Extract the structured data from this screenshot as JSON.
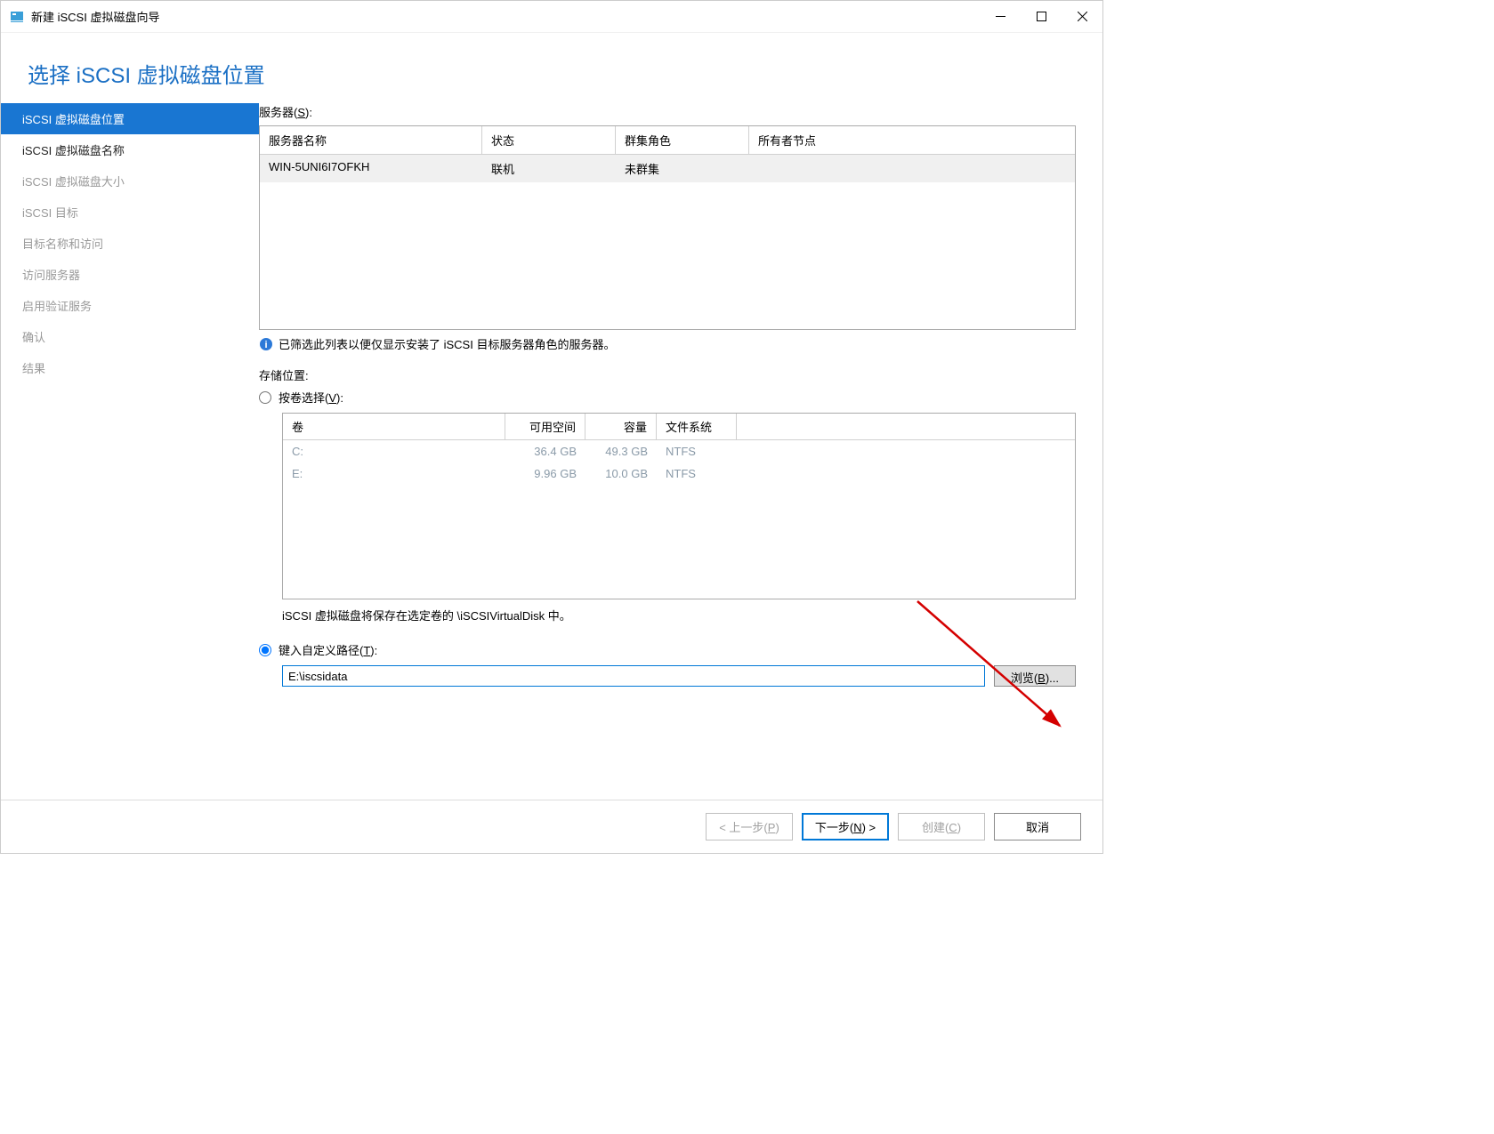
{
  "titlebar": {
    "title": "新建 iSCSI 虚拟磁盘向导"
  },
  "page": {
    "heading": "选择 iSCSI 虚拟磁盘位置"
  },
  "nav": {
    "items": [
      {
        "label": "iSCSI 虚拟磁盘位置",
        "state": "active"
      },
      {
        "label": "iSCSI 虚拟磁盘名称",
        "state": "enabled"
      },
      {
        "label": "iSCSI 虚拟磁盘大小",
        "state": "disabled"
      },
      {
        "label": "iSCSI 目标",
        "state": "disabled"
      },
      {
        "label": "目标名称和访问",
        "state": "disabled"
      },
      {
        "label": "访问服务器",
        "state": "disabled"
      },
      {
        "label": "启用验证服务",
        "state": "disabled"
      },
      {
        "label": "确认",
        "state": "disabled"
      },
      {
        "label": "结果",
        "state": "disabled"
      }
    ]
  },
  "server": {
    "label": "服务器(S):",
    "columns": {
      "name": "服务器名称",
      "status": "状态",
      "role": "群集角色",
      "owner": "所有者节点"
    },
    "rows": [
      {
        "name": "WIN-5UNI6I7OFKH",
        "status": "联机",
        "role": "未群集",
        "owner": ""
      }
    ],
    "info": "已筛选此列表以便仅显示安装了 iSCSI 目标服务器角色的服务器。"
  },
  "storage": {
    "label": "存储位置:",
    "by_volume": {
      "label": "按卷选择(V):",
      "columns": {
        "vol": "卷",
        "free": "可用空间",
        "cap": "容量",
        "fs": "文件系统"
      },
      "rows": [
        {
          "vol": "C:",
          "free": "36.4 GB",
          "cap": "49.3 GB",
          "fs": "NTFS"
        },
        {
          "vol": "E:",
          "free": "9.96 GB",
          "cap": "10.0 GB",
          "fs": "NTFS"
        }
      ],
      "note": "iSCSI 虚拟磁盘将保存在选定卷的 \\iSCSIVirtualDisk 中。"
    },
    "custom_path": {
      "label": "键入自定义路径(T):",
      "value": "E:\\iscsidata",
      "browse": "浏览(B)..."
    },
    "selected": "custom"
  },
  "buttons": {
    "prev": "< 上一步(P)",
    "next": "下一步(N) >",
    "create": "创建(C)",
    "cancel": "取消"
  }
}
